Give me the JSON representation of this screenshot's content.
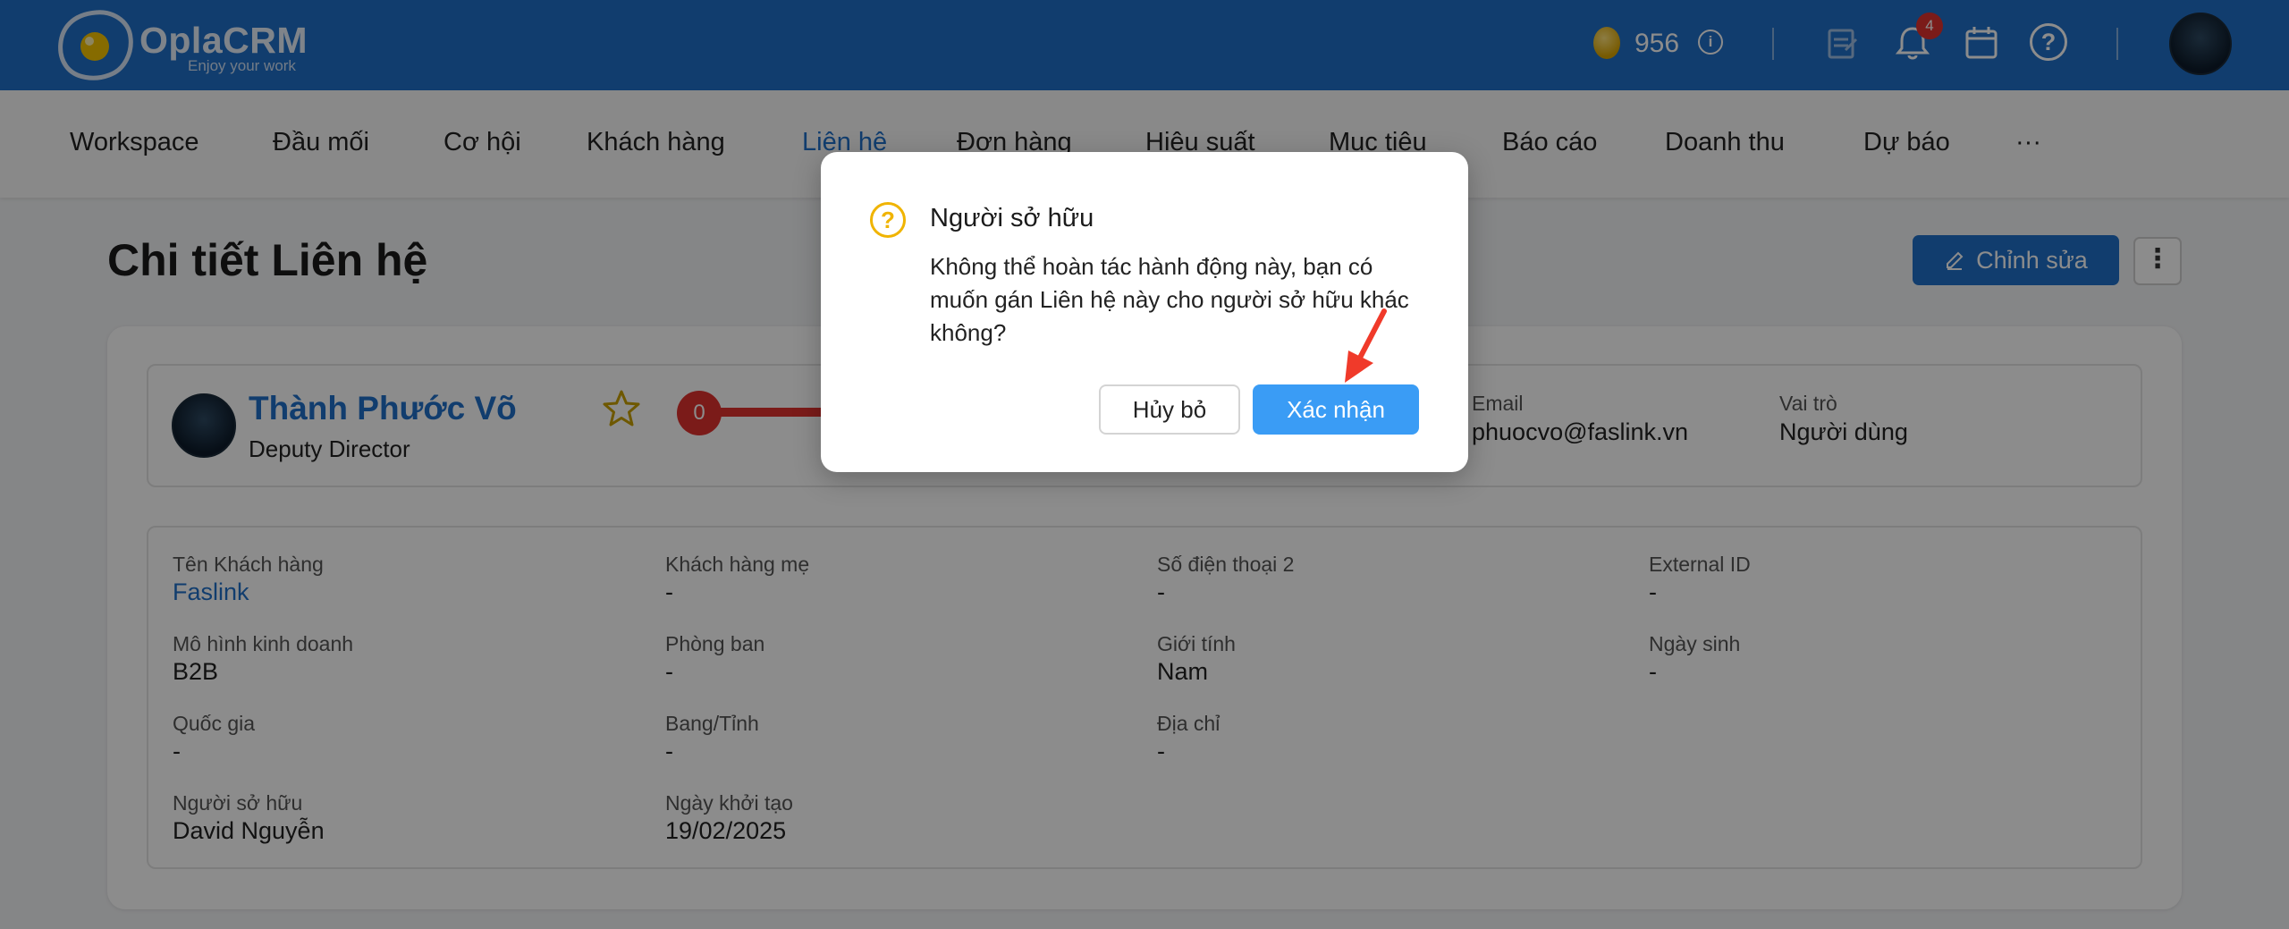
{
  "app": {
    "brand": "OplaCRM",
    "tagline": "Enjoy your work",
    "coins": "956",
    "notification_count": "4",
    "primary_color": "#1f6fc9"
  },
  "nav": {
    "items": [
      "Workspace",
      "Đầu mối",
      "Cơ hội",
      "Khách hàng",
      "Liên hệ",
      "Đơn hàng",
      "Hiệu suất",
      "Mục tiêu",
      "Báo cáo",
      "Doanh thu",
      "Dự báo",
      "···"
    ],
    "active": "Liên hệ"
  },
  "page": {
    "title": "Chi tiết Liên hệ",
    "edit_label": "Chỉnh sửa",
    "more_label": "⋮"
  },
  "contact": {
    "name": "Thành Phước Võ",
    "role": "Deputy Director",
    "score": "0",
    "email_label": "Email",
    "email": "phuocvo@faslink.vn",
    "role_label": "Vai trò",
    "user_role": "Người dùng"
  },
  "details": [
    {
      "label": "Tên Khách hàng",
      "value": "Faslink"
    },
    {
      "label": "Khách hàng mẹ",
      "value": "-"
    },
    {
      "label": "Số điện thoại 2",
      "value": "-"
    },
    {
      "label": "External ID",
      "value": "-"
    },
    {
      "label": "Mô hình kinh doanh",
      "value": "B2B"
    },
    {
      "label": "Phòng ban",
      "value": "-"
    },
    {
      "label": "Giới tính",
      "value": "Nam"
    },
    {
      "label": "Ngày sinh",
      "value": "-"
    },
    {
      "label": "Quốc gia",
      "value": "-"
    },
    {
      "label": "Bang/Tỉnh",
      "value": "-"
    },
    {
      "label": "Địa chỉ",
      "value": "-"
    },
    {
      "label": "Người sở hữu",
      "value": "David Nguyễn"
    },
    {
      "label": "Ngày khởi tạo",
      "value": "19/02/2025"
    }
  ],
  "modal": {
    "title": "Người sở hữu",
    "body": "Không thể hoàn tác hành động này, bạn có muốn gán Liên hệ này cho người sở hữu khác không?",
    "cancel_label": "Hủy bỏ",
    "confirm_label": "Xác nhận"
  }
}
